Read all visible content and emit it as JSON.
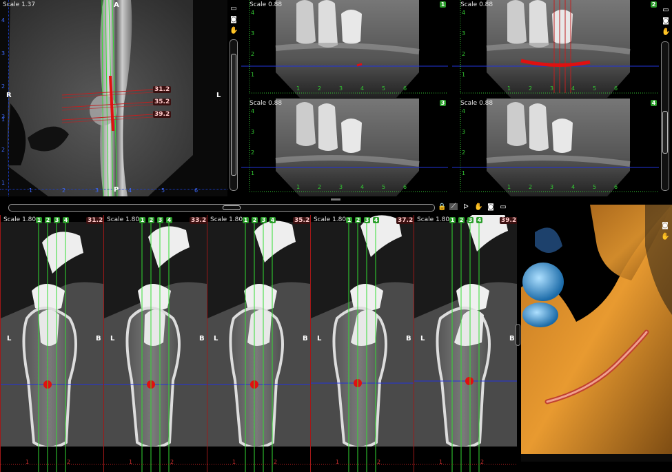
{
  "axial": {
    "scale": "Scale 1.37",
    "orient": {
      "top": "A",
      "left": "R",
      "right": "L",
      "bottom": "P"
    },
    "section_labels": [
      "31.2",
      "35.2",
      "39.2"
    ],
    "v_ticks": [
      "4",
      "3",
      "2",
      "1"
    ],
    "v_ticks_low": [
      "3",
      "2",
      "1"
    ],
    "h_ticks": [
      "1",
      "2",
      "3",
      "4",
      "5",
      "6"
    ]
  },
  "pano": [
    {
      "id": "1",
      "scale": "Scale 0.88",
      "v_ticks": [
        "4",
        "3",
        "2",
        "1"
      ],
      "h_ticks": [
        "1",
        "2",
        "3",
        "4",
        "5",
        "6"
      ]
    },
    {
      "id": "2",
      "scale": "Scale 0.88",
      "v_ticks": [
        "4",
        "3",
        "2",
        "1"
      ],
      "h_ticks": [
        "1",
        "2",
        "3",
        "4",
        "5",
        "6"
      ]
    },
    {
      "id": "3",
      "scale": "Scale 0.88",
      "v_ticks": [
        "4",
        "3",
        "2",
        "1"
      ],
      "h_ticks": [
        "1",
        "2",
        "3",
        "4",
        "5",
        "6"
      ]
    },
    {
      "id": "4",
      "scale": "Scale 0.88",
      "v_ticks": [
        "4",
        "3",
        "2",
        "1"
      ],
      "h_ticks": [
        "1",
        "2",
        "3",
        "4",
        "5",
        "6"
      ]
    }
  ],
  "cross": [
    {
      "scale": "Scale 1.80",
      "pos": "31.2",
      "left": "L",
      "right": "B"
    },
    {
      "scale": "Scale 1.80",
      "pos": "33.2",
      "left": "L",
      "right": "B"
    },
    {
      "scale": "Scale 1.80",
      "pos": "35.2",
      "left": "L",
      "right": "B"
    },
    {
      "scale": "Scale 1.80",
      "pos": "37.2",
      "left": "L",
      "right": "B"
    },
    {
      "scale": "Scale 1.80",
      "pos": "39.2",
      "left": "L",
      "right": "B"
    }
  ],
  "cross_lines": [
    "1",
    "2",
    "3",
    "4"
  ],
  "cross_ticks": [
    "1",
    "2"
  ],
  "toolbar_mid": [
    "lock-icon",
    "ruler-icon",
    "nerve-icon",
    "hand-icon",
    "camera-icon",
    "window-icon"
  ],
  "toolbar_right": [
    "window-icon",
    "camera-icon",
    "hand-icon"
  ],
  "colors": {
    "nerve": "#e01010",
    "green_line": "#33dd33",
    "blue_line": "#2233dd",
    "ruler_red": "#c02020"
  }
}
